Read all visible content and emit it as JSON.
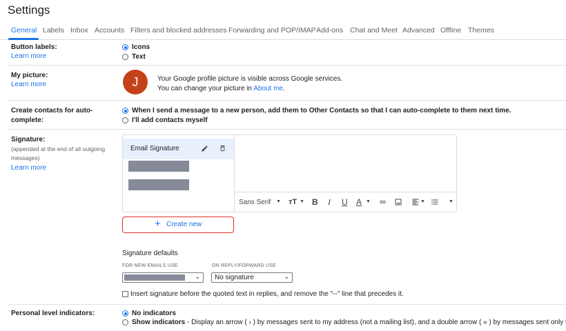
{
  "title": "Settings",
  "tabs": [
    "General",
    "Labels",
    "Inbox",
    "Accounts",
    "Filters and blocked addresses",
    "Forwarding and POP/IMAP",
    "Add-ons",
    "Chat and Meet",
    "Advanced",
    "Offline",
    "Themes"
  ],
  "active_tab": "General",
  "button_labels": {
    "label": "Button labels:",
    "learn_more": "Learn more",
    "options": [
      "Icons",
      "Text"
    ],
    "selected": "Icons"
  },
  "my_picture": {
    "label": "My picture:",
    "learn_more": "Learn more",
    "avatar_letter": "J",
    "avatar_color": "#c5411a",
    "line1": "Your Google profile picture is visible across Google services.",
    "line2_prefix": "You can change your picture in ",
    "line2_link": "About me",
    "line2_suffix": "."
  },
  "create_contacts": {
    "label_line1": "Create contacts for auto-",
    "label_line2": "complete:",
    "options": [
      "When I send a message to a new person, add them to Other Contacts so that I can auto-complete to them next time.",
      "I'll add contacts myself"
    ],
    "selected_index": 0
  },
  "signature": {
    "label": "Signature:",
    "note_line1": "(appended at the end of all outgoing",
    "note_line2": "messages)",
    "learn_more": "Learn more",
    "items": [
      "Email Signature"
    ],
    "toolbar": {
      "font": "Sans Serif"
    },
    "create_new": "Create new",
    "defaults_title": "Signature defaults",
    "new_emails_caption": "FOR NEW EMAILS USE",
    "reply_caption": "ON REPLY/FORWARD USE",
    "reply_value": "No signature",
    "insert_checkbox": "Insert signature before the quoted text in replies, and remove the \"--\" line that precedes it."
  },
  "personal_level": {
    "label": "Personal level indicators:",
    "no_indicators": "No indicators",
    "show_indicators": "Show indicators",
    "show_description": " - Display an arrow ( › ) by messages sent to my address (not a mailing list), and a double arrow ( » ) by messages sent only to me.",
    "selected": "No indicators"
  },
  "colors": {
    "accent": "#1a73e8",
    "highlight_border": "#d93025",
    "redacted": "#868a99"
  }
}
